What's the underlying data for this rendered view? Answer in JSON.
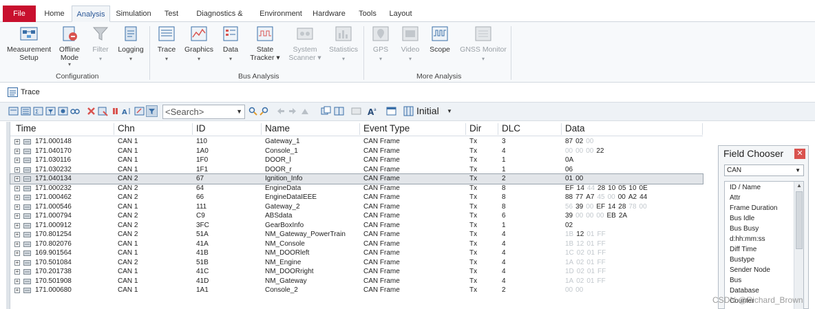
{
  "menu": {
    "tabs": [
      "File",
      "Home",
      "Analysis",
      "Simulation",
      "Test",
      "Diagnostics & XCP",
      "Environment",
      "Hardware",
      "Tools",
      "Layout"
    ]
  },
  "ribbon": {
    "buttons": [
      {
        "label": "Measurement",
        "label2": "Setup",
        "icon": "measurement-setup-icon"
      },
      {
        "label": "Offline",
        "label2": "Mode",
        "icon": "offline-mode-icon"
      },
      {
        "label": "Filter",
        "label2": "",
        "icon": "filter-icon"
      },
      {
        "label": "Logging",
        "label2": "",
        "icon": "logging-icon"
      },
      {
        "label": "Trace",
        "label2": "",
        "icon": "trace-icon"
      },
      {
        "label": "Graphics",
        "label2": "",
        "icon": "graphics-icon"
      },
      {
        "label": "Data",
        "label2": "",
        "icon": "data-icon"
      },
      {
        "label": "State",
        "label2": "Tracker",
        "icon": "state-tracker-icon"
      },
      {
        "label": "System",
        "label2": "Scanner",
        "icon": "system-scanner-icon"
      },
      {
        "label": "Statistics",
        "label2": "",
        "icon": "statistics-icon"
      },
      {
        "label": "GPS",
        "label2": "",
        "icon": "gps-icon"
      },
      {
        "label": "Video",
        "label2": "",
        "icon": "video-icon"
      },
      {
        "label": "Scope",
        "label2": "",
        "icon": "scope-icon"
      },
      {
        "label": "GNSS Monitor",
        "label2": "",
        "icon": "gnss-monitor-icon"
      }
    ],
    "groups": [
      "Configuration",
      "Bus Analysis",
      "More Analysis"
    ]
  },
  "trace": {
    "title": "Trace",
    "search_placeholder": "<Search>",
    "layout_label": "Initial"
  },
  "grid": {
    "columns": [
      "Time",
      "Chn",
      "ID",
      "Name",
      "Event Type",
      "Dir",
      "DLC",
      "Data"
    ],
    "rows": [
      {
        "time": "171.000148",
        "chn": "CAN 1",
        "id": "110",
        "name": "Gateway_1",
        "event": "CAN Frame",
        "dir": "Tx",
        "dlc": "3",
        "data": [
          [
            "87",
            0
          ],
          [
            "02",
            0
          ],
          [
            "00",
            1
          ]
        ]
      },
      {
        "time": "171.040170",
        "chn": "CAN 1",
        "id": "1A0",
        "name": "Console_1",
        "event": "CAN Frame",
        "dir": "Tx",
        "dlc": "4",
        "data": [
          [
            "00",
            1
          ],
          [
            "00",
            1
          ],
          [
            "00",
            1
          ],
          [
            "22",
            0
          ]
        ]
      },
      {
        "time": "171.030116",
        "chn": "CAN 1",
        "id": "1F0",
        "name": "DOOR_l",
        "event": "CAN Frame",
        "dir": "Tx",
        "dlc": "1",
        "data": [
          [
            "0A",
            0
          ]
        ]
      },
      {
        "time": "171.030232",
        "chn": "CAN 1",
        "id": "1F1",
        "name": "DOOR_r",
        "event": "CAN Frame",
        "dir": "Tx",
        "dlc": "1",
        "data": [
          [
            "06",
            0
          ]
        ]
      },
      {
        "time": "171.040134",
        "chn": "CAN 2",
        "id": "67",
        "name": "Ignition_Info",
        "event": "CAN Frame",
        "dir": "Tx",
        "dlc": "2",
        "data": [
          [
            "01",
            0
          ],
          [
            "00",
            0
          ]
        ],
        "selected": true
      },
      {
        "time": "171.000232",
        "chn": "CAN 2",
        "id": "64",
        "name": "EngineData",
        "event": "CAN Frame",
        "dir": "Tx",
        "dlc": "8",
        "data": [
          [
            "EF",
            0
          ],
          [
            "14",
            0
          ],
          [
            "44",
            1
          ],
          [
            "28",
            0
          ],
          [
            "10",
            0
          ],
          [
            "05",
            0
          ],
          [
            "10",
            0
          ],
          [
            "0E",
            0
          ]
        ]
      },
      {
        "time": "171.000462",
        "chn": "CAN 2",
        "id": "66",
        "name": "EngineDataIEEE",
        "event": "CAN Frame",
        "dir": "Tx",
        "dlc": "8",
        "data": [
          [
            "88",
            0
          ],
          [
            "77",
            0
          ],
          [
            "A7",
            0
          ],
          [
            "45",
            1
          ],
          [
            "00",
            1
          ],
          [
            "00",
            0
          ],
          [
            "A2",
            0
          ],
          [
            "44",
            0
          ]
        ]
      },
      {
        "time": "171.000546",
        "chn": "CAN 1",
        "id": "111",
        "name": "Gateway_2",
        "event": "CAN Frame",
        "dir": "Tx",
        "dlc": "8",
        "data": [
          [
            "56",
            1
          ],
          [
            "39",
            0
          ],
          [
            "00",
            1
          ],
          [
            "EF",
            0
          ],
          [
            "14",
            0
          ],
          [
            "28",
            0
          ],
          [
            "78",
            1
          ],
          [
            "00",
            1
          ]
        ]
      },
      {
        "time": "171.000794",
        "chn": "CAN 2",
        "id": "C9",
        "name": "ABSdata",
        "event": "CAN Frame",
        "dir": "Tx",
        "dlc": "6",
        "data": [
          [
            "39",
            0
          ],
          [
            "00",
            1
          ],
          [
            "00",
            1
          ],
          [
            "00",
            1
          ],
          [
            "EB",
            0
          ],
          [
            "2A",
            0
          ]
        ]
      },
      {
        "time": "171.000912",
        "chn": "CAN 2",
        "id": "3FC",
        "name": "GearBoxInfo",
        "event": "CAN Frame",
        "dir": "Tx",
        "dlc": "1",
        "data": [
          [
            "02",
            0
          ]
        ]
      },
      {
        "time": "170.801254",
        "chn": "CAN 2",
        "id": "51A",
        "name": "NM_Gateway_PowerTrain",
        "event": "CAN Frame",
        "dir": "Tx",
        "dlc": "4",
        "data": [
          [
            "1B",
            1
          ],
          [
            "12",
            0
          ],
          [
            "01",
            1
          ],
          [
            "FF",
            1
          ]
        ]
      },
      {
        "time": "170.802076",
        "chn": "CAN 1",
        "id": "41A",
        "name": "NM_Console",
        "event": "CAN Frame",
        "dir": "Tx",
        "dlc": "4",
        "data": [
          [
            "1B",
            1
          ],
          [
            "12",
            1
          ],
          [
            "01",
            1
          ],
          [
            "FF",
            1
          ]
        ]
      },
      {
        "time": "169.901564",
        "chn": "CAN 1",
        "id": "41B",
        "name": "NM_DOORleft",
        "event": "CAN Frame",
        "dir": "Tx",
        "dlc": "4",
        "data": [
          [
            "1C",
            1
          ],
          [
            "02",
            1
          ],
          [
            "01",
            1
          ],
          [
            "FF",
            1
          ]
        ]
      },
      {
        "time": "170.501084",
        "chn": "CAN 2",
        "id": "51B",
        "name": "NM_Engine",
        "event": "CAN Frame",
        "dir": "Tx",
        "dlc": "4",
        "data": [
          [
            "1A",
            1
          ],
          [
            "02",
            1
          ],
          [
            "01",
            1
          ],
          [
            "FF",
            1
          ]
        ]
      },
      {
        "time": "170.201738",
        "chn": "CAN 1",
        "id": "41C",
        "name": "NM_DOORright",
        "event": "CAN Frame",
        "dir": "Tx",
        "dlc": "4",
        "data": [
          [
            "1D",
            1
          ],
          [
            "02",
            1
          ],
          [
            "01",
            1
          ],
          [
            "FF",
            1
          ]
        ]
      },
      {
        "time": "170.501908",
        "chn": "CAN 1",
        "id": "41D",
        "name": "NM_Gateway",
        "event": "CAN Frame",
        "dir": "Tx",
        "dlc": "4",
        "data": [
          [
            "1A",
            1
          ],
          [
            "02",
            1
          ],
          [
            "01",
            1
          ],
          [
            "FF",
            1
          ]
        ]
      },
      {
        "time": "171.000680",
        "chn": "CAN 1",
        "id": "1A1",
        "name": "Console_2",
        "event": "CAN Frame",
        "dir": "Tx",
        "dlc": "2",
        "data": [
          [
            "00",
            1
          ],
          [
            "00",
            1
          ]
        ]
      }
    ]
  },
  "field_chooser": {
    "title": "Field Chooser",
    "close": "✕",
    "selected": "CAN",
    "items": [
      "ID / Name",
      "Attr",
      "Frame Duration",
      "Bus Idle",
      "Bus Busy",
      "d:hh:mm:ss",
      "Diff Time",
      "Bustype",
      "Sender Node",
      "Bus",
      "Database",
      "Counter"
    ]
  },
  "watermark": "CSDN @Richard_Brown",
  "colors": {
    "file_tab": "#c8102e",
    "accent": "#2b5797",
    "dim_byte": "#c2c8cd"
  }
}
